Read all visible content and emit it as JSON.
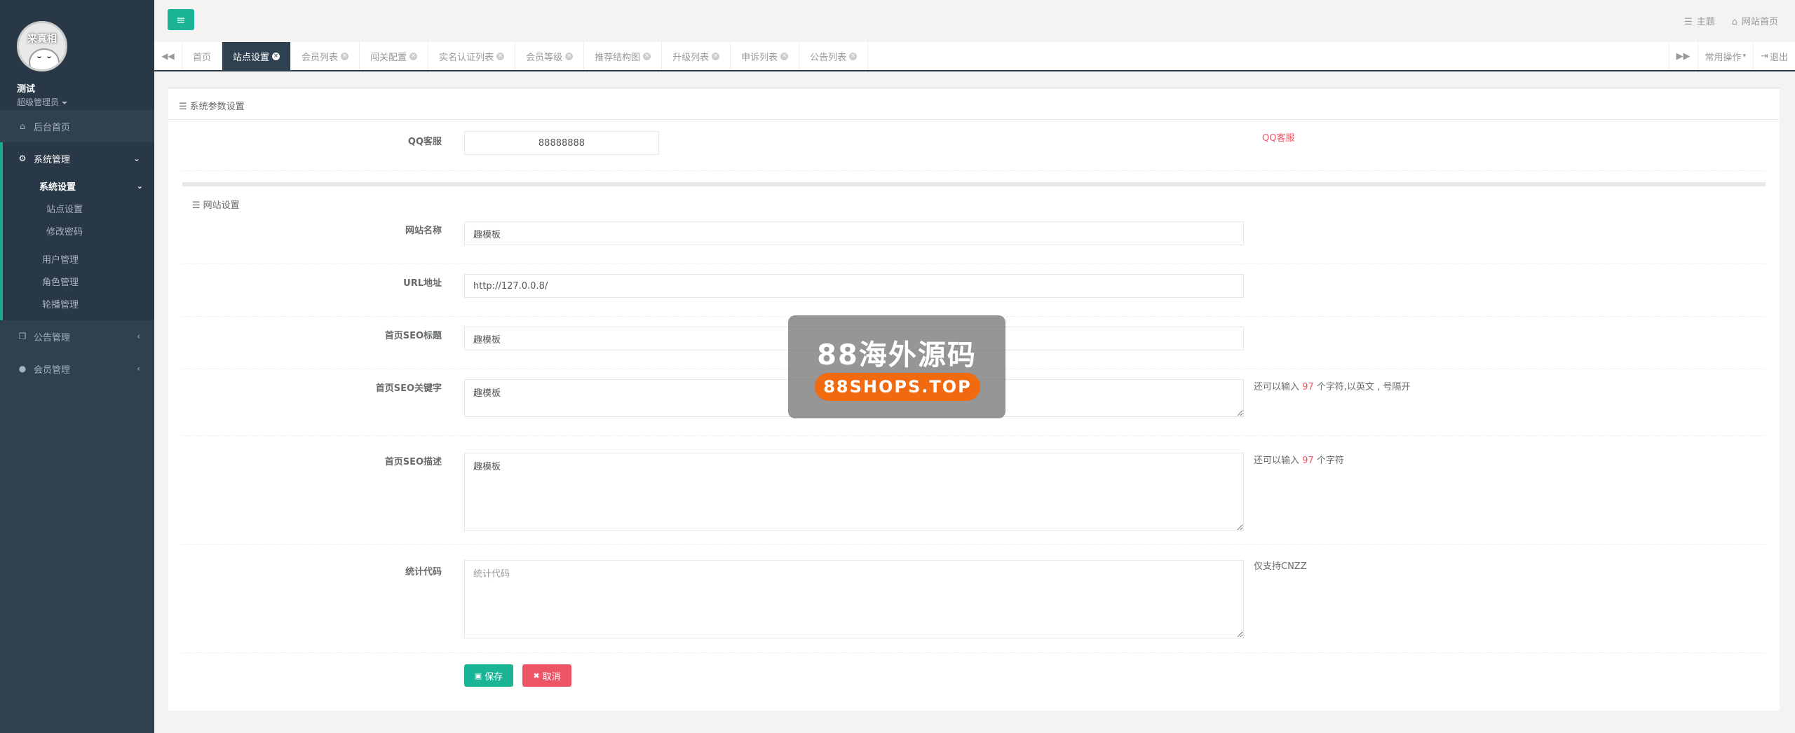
{
  "profile": {
    "avatar_text": "来真相",
    "name": "测试",
    "role": "超级管理员"
  },
  "sidebar": {
    "items": [
      {
        "label": "后台首页",
        "icon": "home-icon"
      },
      {
        "label": "系统管理",
        "icon": "gear-icon"
      },
      {
        "label": "公告管理",
        "icon": "copy-icon"
      },
      {
        "label": "会员管理",
        "icon": "user-icon"
      }
    ],
    "system_sub": {
      "settings_label": "系统设置",
      "site_settings": "站点设置",
      "change_password": "修改密码",
      "user_mgmt": "用户管理",
      "role_mgmt": "角色管理",
      "carousel_mgmt": "轮播管理"
    }
  },
  "topbar": {
    "theme": "主题",
    "home": "网站首页"
  },
  "tabs": [
    {
      "label": "首页",
      "closable": false
    },
    {
      "label": "站点设置",
      "closable": true,
      "active": true
    },
    {
      "label": "会员列表",
      "closable": true
    },
    {
      "label": "闯关配置",
      "closable": true
    },
    {
      "label": "实名认证列表",
      "closable": true
    },
    {
      "label": "会员等级",
      "closable": true
    },
    {
      "label": "推荐结构图",
      "closable": true
    },
    {
      "label": "升级列表",
      "closable": true
    },
    {
      "label": "申诉列表",
      "closable": true
    },
    {
      "label": "公告列表",
      "closable": true
    }
  ],
  "tab_right": {
    "common_ops": "常用操作",
    "logout": "退出"
  },
  "panel": {
    "title": "系统参数设置",
    "qq_label": "QQ客服",
    "qq_value": "88888888",
    "qq_help": "QQ客服",
    "site_section": "网站设置",
    "site_name_label": "网站名称",
    "site_name_value": "趣模板",
    "url_label": "URL地址",
    "url_value": "http://127.0.0.8/",
    "seo_title_label": "首页SEO标题",
    "seo_title_value": "趣模板",
    "seo_kw_label": "首页SEO关键字",
    "seo_kw_value": "趣模板",
    "seo_kw_help_pre": "还可以输入",
    "seo_kw_help_num": "97",
    "seo_kw_help_post": "个字符,以英文 , 号隔开",
    "seo_desc_label": "首页SEO描述",
    "seo_desc_value": "趣模板",
    "seo_desc_help_pre": "还可以输入",
    "seo_desc_help_num": "97",
    "seo_desc_help_post": "个字符",
    "stats_label": "统计代码",
    "stats_placeholder": "统计代码",
    "stats_help": "仅支持CNZZ",
    "save": "保存",
    "cancel": "取消"
  },
  "watermark": {
    "title": "88海外源码",
    "url": "88SHOPS.TOP"
  },
  "colors": {
    "sidebar": "#2f4050",
    "accent": "#1ab394",
    "danger": "#ed5565"
  }
}
